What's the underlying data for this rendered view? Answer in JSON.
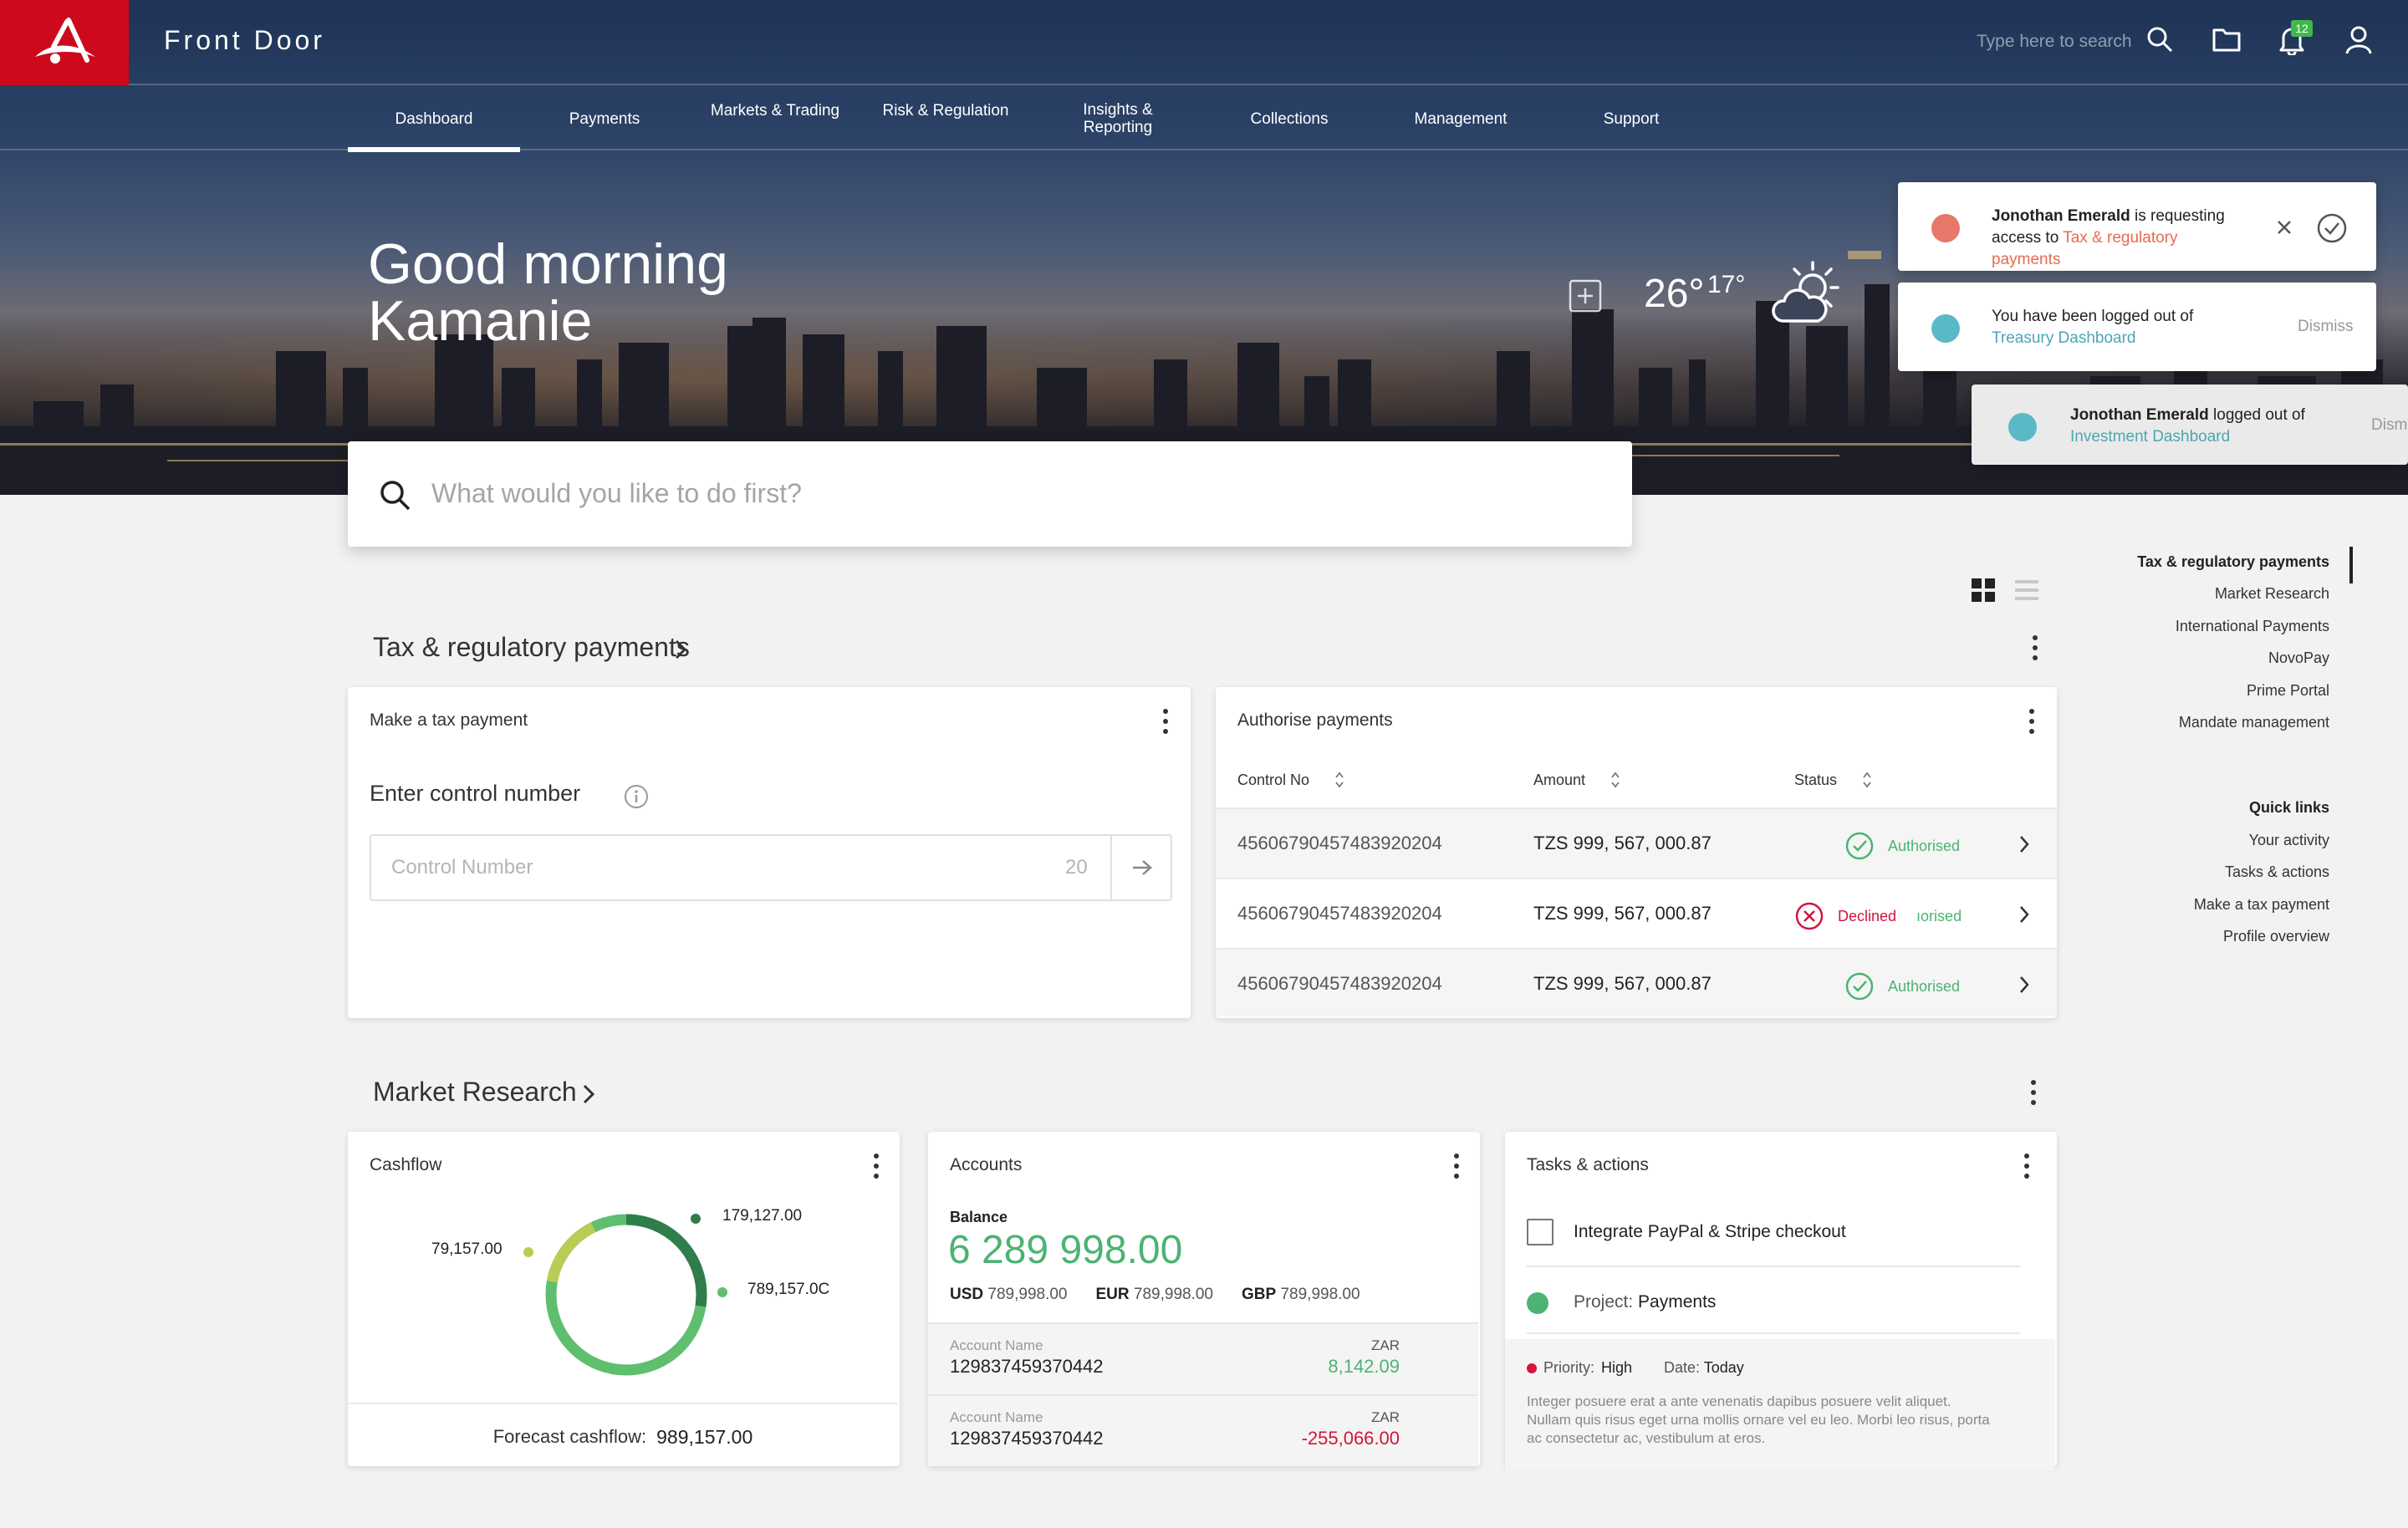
{
  "header": {
    "app_title": "Front Door",
    "search_hint": "Type here to search",
    "notification_count": "12",
    "brand_color": "#cc0a1c"
  },
  "nav": [
    {
      "label": "Dashboard",
      "active": true
    },
    {
      "label": "Payments"
    },
    {
      "label": "Markets & Trading"
    },
    {
      "label": "Risk & Regulation"
    },
    {
      "label": "Insights & Reporting"
    },
    {
      "label": "Collections"
    },
    {
      "label": "Management"
    },
    {
      "label": "Support"
    }
  ],
  "hero": {
    "greeting_line1": "Good morning",
    "greeting_line2": "Kamanie",
    "temp": "26°",
    "temp_low": "17°",
    "weather_icon": "partly-cloudy-icon"
  },
  "notifications": [
    {
      "name": "Jonothan Emerald",
      "text": "is requesting access to",
      "link": "Tax & regulatory payments",
      "dot_color": "#e8786a"
    },
    {
      "text": "You have been logged out of",
      "link": "Treasury Dashboard",
      "action": "Dismiss",
      "dot_color": "#5ab9c6"
    },
    {
      "name": "Jonothan Emerald",
      "text": "logged out of",
      "link": "Investment Dashboard",
      "action": "Dism",
      "dot_color": "#5ab9c6"
    }
  ],
  "main_search": {
    "placeholder": "What would you like to do first?"
  },
  "side_nav": {
    "sections": [
      "Tax & regulatory payments",
      "Market Research",
      "International Payments",
      "NovoPay",
      "Prime Portal",
      "Mandate management"
    ],
    "quick_links_title": "Quick links",
    "quick_links": [
      "Your activity",
      "Tasks & actions",
      "Make a tax payment",
      "Profile overview"
    ]
  },
  "tax_section": {
    "title": "Tax & regulatory payments",
    "make_payment": {
      "title": "Make a tax payment",
      "label": "Enter control number",
      "placeholder": "Control Number",
      "max_length": "20"
    },
    "authorise": {
      "title": "Authorise payments",
      "columns": [
        "Control No",
        "Amount",
        "Status"
      ],
      "rows": [
        {
          "control_no": "45606790457483920204",
          "amount": "TZS 999, 567, 000.87",
          "status": "Authorised"
        },
        {
          "control_no": "45606790457483920204",
          "amount": "TZS 999, 567, 000.87",
          "status": "Declined",
          "ghost": "ıorised"
        },
        {
          "control_no": "45606790457483920204",
          "amount": "TZS 999, 567, 000.87",
          "status": "Authorised"
        }
      ]
    }
  },
  "market_section": {
    "title": "Market Research",
    "cashflow": {
      "title": "Cashflow",
      "labels": [
        "179,127.00",
        "789,157.0C",
        "79,157.00"
      ],
      "forecast_label": "Forecast cashflow:",
      "forecast_value": "989,157.00",
      "colors": [
        "#2f7d4a",
        "#5fbf6e",
        "#b9cc55"
      ]
    },
    "accounts": {
      "title": "Accounts",
      "balance_label": "Balance",
      "balance": "6 289 998.00",
      "currencies": [
        {
          "code": "USD",
          "value": "789,998.00"
        },
        {
          "code": "EUR",
          "value": "789,998.00"
        },
        {
          "code": "GBP",
          "value": "789,998.00"
        }
      ],
      "rows": [
        {
          "name_label": "Account Name",
          "number": "129837459370442",
          "currency": "ZAR",
          "value": "8,142.09",
          "color": "#4cb373"
        },
        {
          "name_label": "Account Name",
          "number": "129837459370442",
          "currency": "ZAR",
          "value": "-255,066.00",
          "color": "#d4143c"
        }
      ]
    },
    "tasks": {
      "title": "Tasks & actions",
      "task": "Integrate PayPal & Stripe checkout",
      "project_label": "Project:",
      "project": "Payments",
      "priority_label": "Priority:",
      "priority": "High",
      "date_label": "Date:",
      "date": "Today",
      "description": "Integer posuere erat a ante venenatis dapibus posuere velit aliquet. Nullam quis risus eget urna mollis ornare vel eu leo. Morbi leo risus, porta ac consectetur ac, vestibulum at eros."
    }
  }
}
